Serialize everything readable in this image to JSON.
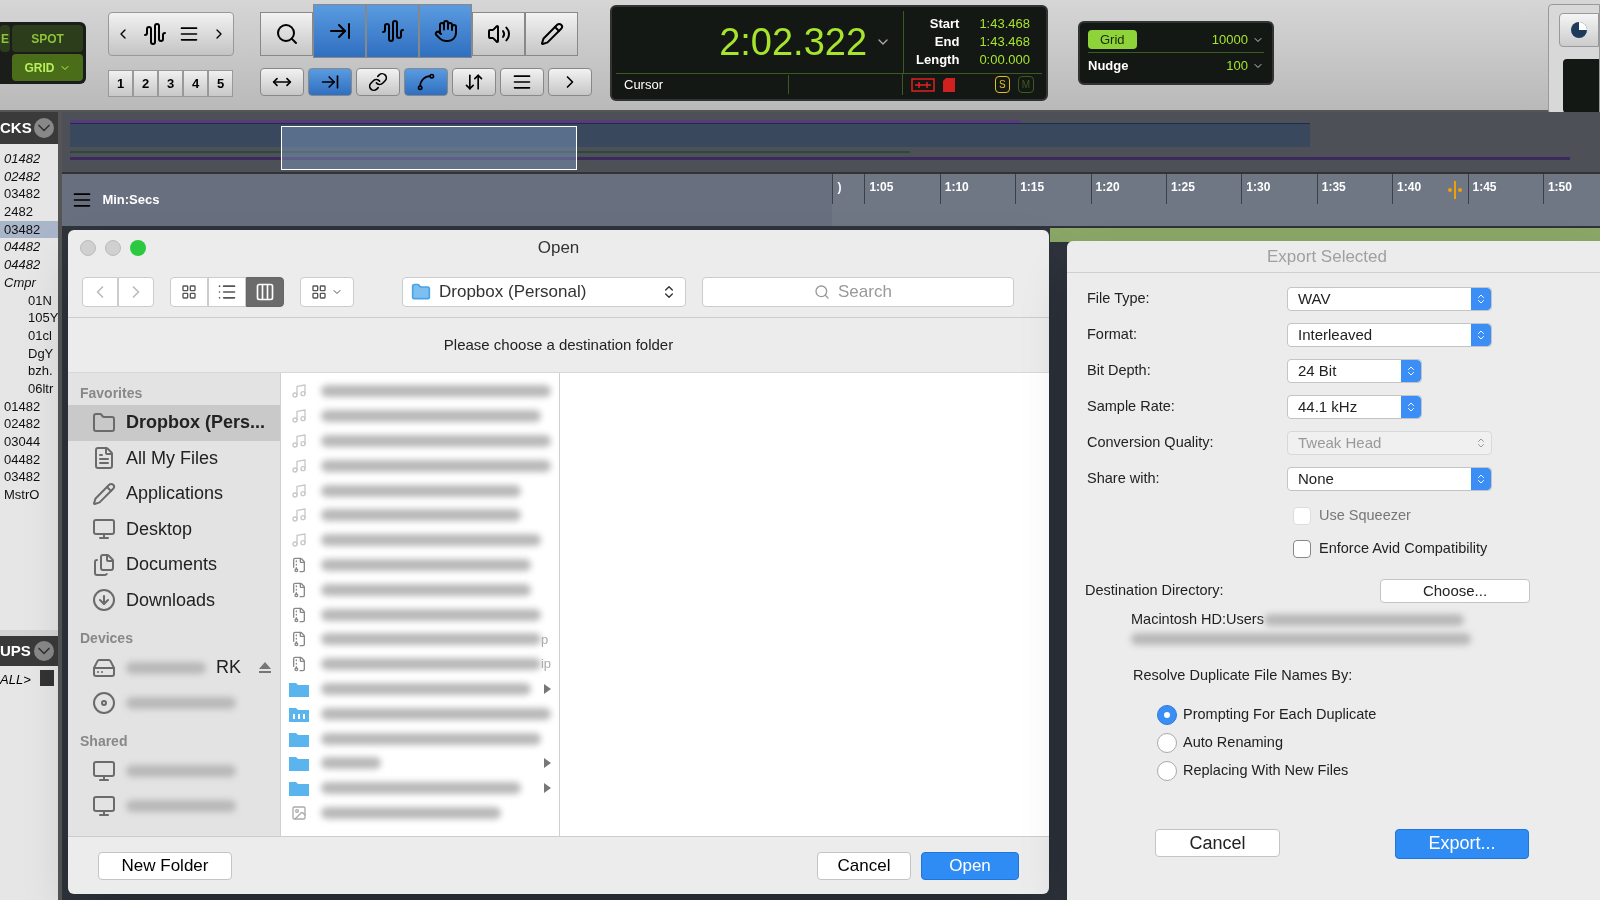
{
  "edit_modes": [
    {
      "label": "E",
      "selected": false
    },
    {
      "label": "SPOT",
      "selected": false
    },
    {
      "label": "GRID",
      "selected": true
    }
  ],
  "zoom_presets": [
    "1",
    "2",
    "3",
    "4",
    "5"
  ],
  "tools": [
    {
      "kind": "zoom",
      "selected": false
    },
    {
      "kind": "trim",
      "selected": true
    },
    {
      "kind": "select",
      "selected": true
    },
    {
      "kind": "grab",
      "selected": true
    },
    {
      "kind": "scrub",
      "selected": false
    },
    {
      "kind": "pencil",
      "selected": false
    }
  ],
  "tool_options": [
    {
      "kind": "zoom-toggle",
      "selected": false
    },
    {
      "kind": "tab-transients",
      "selected": true
    },
    {
      "kind": "link-timeline",
      "selected": false
    },
    {
      "kind": "link-tracks",
      "selected": true
    },
    {
      "kind": "insertion-follows",
      "selected": false
    },
    {
      "kind": "mirror-midi",
      "selected": false
    },
    {
      "kind": "auto-scroll",
      "selected": false
    }
  ],
  "counter": {
    "main": "2:02.322",
    "rows": [
      {
        "label": "Start",
        "value": "1:43.468"
      },
      {
        "label": "End",
        "value": "1:43.468"
      },
      {
        "label": "Length",
        "value": "0:00.000"
      }
    ],
    "cursor_label": "Cursor",
    "solo_label": "S",
    "mute_label": "M"
  },
  "grid": {
    "label": "Grid",
    "value": "10000",
    "nudge_label": "Nudge",
    "nudge_value": "100"
  },
  "tracks_panel": {
    "title": "CKS",
    "items": [
      {
        "name": "01482",
        "italic": true,
        "selected": false
      },
      {
        "name": "02482",
        "italic": true,
        "selected": false
      },
      {
        "name": "03482",
        "italic": false,
        "selected": false
      },
      {
        "name": "2482",
        "italic": false,
        "selected": false
      },
      {
        "name": "03482",
        "italic": false,
        "selected": true
      },
      {
        "name": "04482",
        "italic": true,
        "selected": false
      },
      {
        "name": "04482",
        "italic": true,
        "selected": false
      },
      {
        "name": "Cmpr",
        "italic": true,
        "selected": false,
        "children": [
          {
            "name": "01N",
            "italic": false,
            "selected": false
          },
          {
            "name": "105Y",
            "italic": false,
            "selected": false
          },
          {
            "name": "01cl",
            "italic": false,
            "selected": false
          },
          {
            "name": "DgY",
            "italic": false,
            "selected": false
          },
          {
            "name": "bzh.",
            "italic": false,
            "selected": false
          },
          {
            "name": "06ltr",
            "italic": false,
            "selected": false
          }
        ]
      },
      {
        "name": "01482",
        "italic": false,
        "selected": false
      },
      {
        "name": "02482",
        "italic": false,
        "selected": false
      },
      {
        "name": "03044",
        "italic": false,
        "selected": false
      },
      {
        "name": "04482",
        "italic": false,
        "selected": false
      },
      {
        "name": "03482",
        "italic": false,
        "selected": false
      },
      {
        "name": "MstrO",
        "italic": false,
        "selected": false
      }
    ]
  },
  "groups_panel": {
    "title": "UPS",
    "items": [
      "ALL>"
    ]
  },
  "ruler": {
    "label": "Min:Secs",
    "ticks": [
      ")",
      "1:05",
      "1:10",
      "1:15",
      "1:20",
      "1:25",
      "1:30",
      "1:35",
      "1:40",
      "1:45",
      "1:50"
    ]
  },
  "open_dialog": {
    "title": "Open",
    "location": "Dropbox (Personal)",
    "search": {
      "placeholder": "Search"
    },
    "prompt": "Please choose a destination folder",
    "sidebar": [
      {
        "heading": "Favorites",
        "items": [
          {
            "kind": "folder",
            "label": "Dropbox (Pers...",
            "selected": true
          },
          {
            "kind": "all-files",
            "label": "All My Files",
            "selected": false
          },
          {
            "kind": "applications",
            "label": "Applications",
            "selected": false
          },
          {
            "kind": "desktop",
            "label": "Desktop",
            "selected": false
          },
          {
            "kind": "documents",
            "label": "Documents",
            "selected": false
          },
          {
            "kind": "downloads",
            "label": "Downloads",
            "selected": false
          }
        ]
      },
      {
        "heading": "Devices",
        "items": [
          {
            "kind": "disk",
            "label": "RK",
            "selected": false
          },
          {
            "kind": "optical",
            "selected": false
          }
        ]
      },
      {
        "heading": "Shared",
        "items": [
          {
            "kind": "computer",
            "selected": false
          },
          {
            "kind": "computer",
            "selected": false
          }
        ]
      }
    ],
    "files": [
      {
        "kind": "audio"
      },
      {
        "kind": "audio"
      },
      {
        "kind": "audio"
      },
      {
        "kind": "audio"
      },
      {
        "kind": "audio"
      },
      {
        "kind": "audio"
      },
      {
        "kind": "audio"
      },
      {
        "kind": "zip"
      },
      {
        "kind": "zip"
      },
      {
        "kind": "zip"
      },
      {
        "kind": "zip",
        "suffix": "p"
      },
      {
        "kind": "zip",
        "suffix": "ip"
      },
      {
        "kind": "folder",
        "disclosure": true
      },
      {
        "kind": "app-folder",
        "disclosure": false
      },
      {
        "kind": "folder",
        "disclosure": false
      },
      {
        "kind": "folder",
        "disclosure": true
      },
      {
        "kind": "folder",
        "disclosure": true
      },
      {
        "kind": "image",
        "disclosure": false
      }
    ],
    "buttons": {
      "new_folder": "New Folder",
      "cancel": "Cancel",
      "open": "Open"
    }
  },
  "export_dialog": {
    "title": "Export Selected",
    "fields": [
      {
        "label": "File Type:",
        "value": "WAV",
        "wide": true,
        "disabled": false
      },
      {
        "label": "Format:",
        "value": "Interleaved",
        "wide": true,
        "disabled": false
      },
      {
        "label": "Bit Depth:",
        "value": "24 Bit",
        "wide": false,
        "disabled": false
      },
      {
        "label": "Sample Rate:",
        "value": "44.1 kHz",
        "wide": false,
        "disabled": false
      },
      {
        "label": "Conversion Quality:",
        "value": "Tweak Head",
        "wide": true,
        "disabled": true
      },
      {
        "label": "Share with:",
        "value": "None",
        "wide": true,
        "disabled": false
      }
    ],
    "checkboxes": [
      {
        "label": "Use Squeezer",
        "checked": false,
        "disabled": true
      },
      {
        "label": "Enforce Avid Compatibility",
        "checked": false,
        "disabled": false
      }
    ],
    "destination_label": "Destination Directory:",
    "choose": "Choose...",
    "path": "Macintosh HD:Users",
    "resolve_label": "Resolve Duplicate File Names By:",
    "radios": [
      {
        "label": "Prompting For Each Duplicate",
        "selected": true
      },
      {
        "label": "Auto Renaming",
        "selected": false
      },
      {
        "label": "Replacing With New Files",
        "selected": false
      }
    ],
    "cancel": "Cancel",
    "export": "Export..."
  }
}
